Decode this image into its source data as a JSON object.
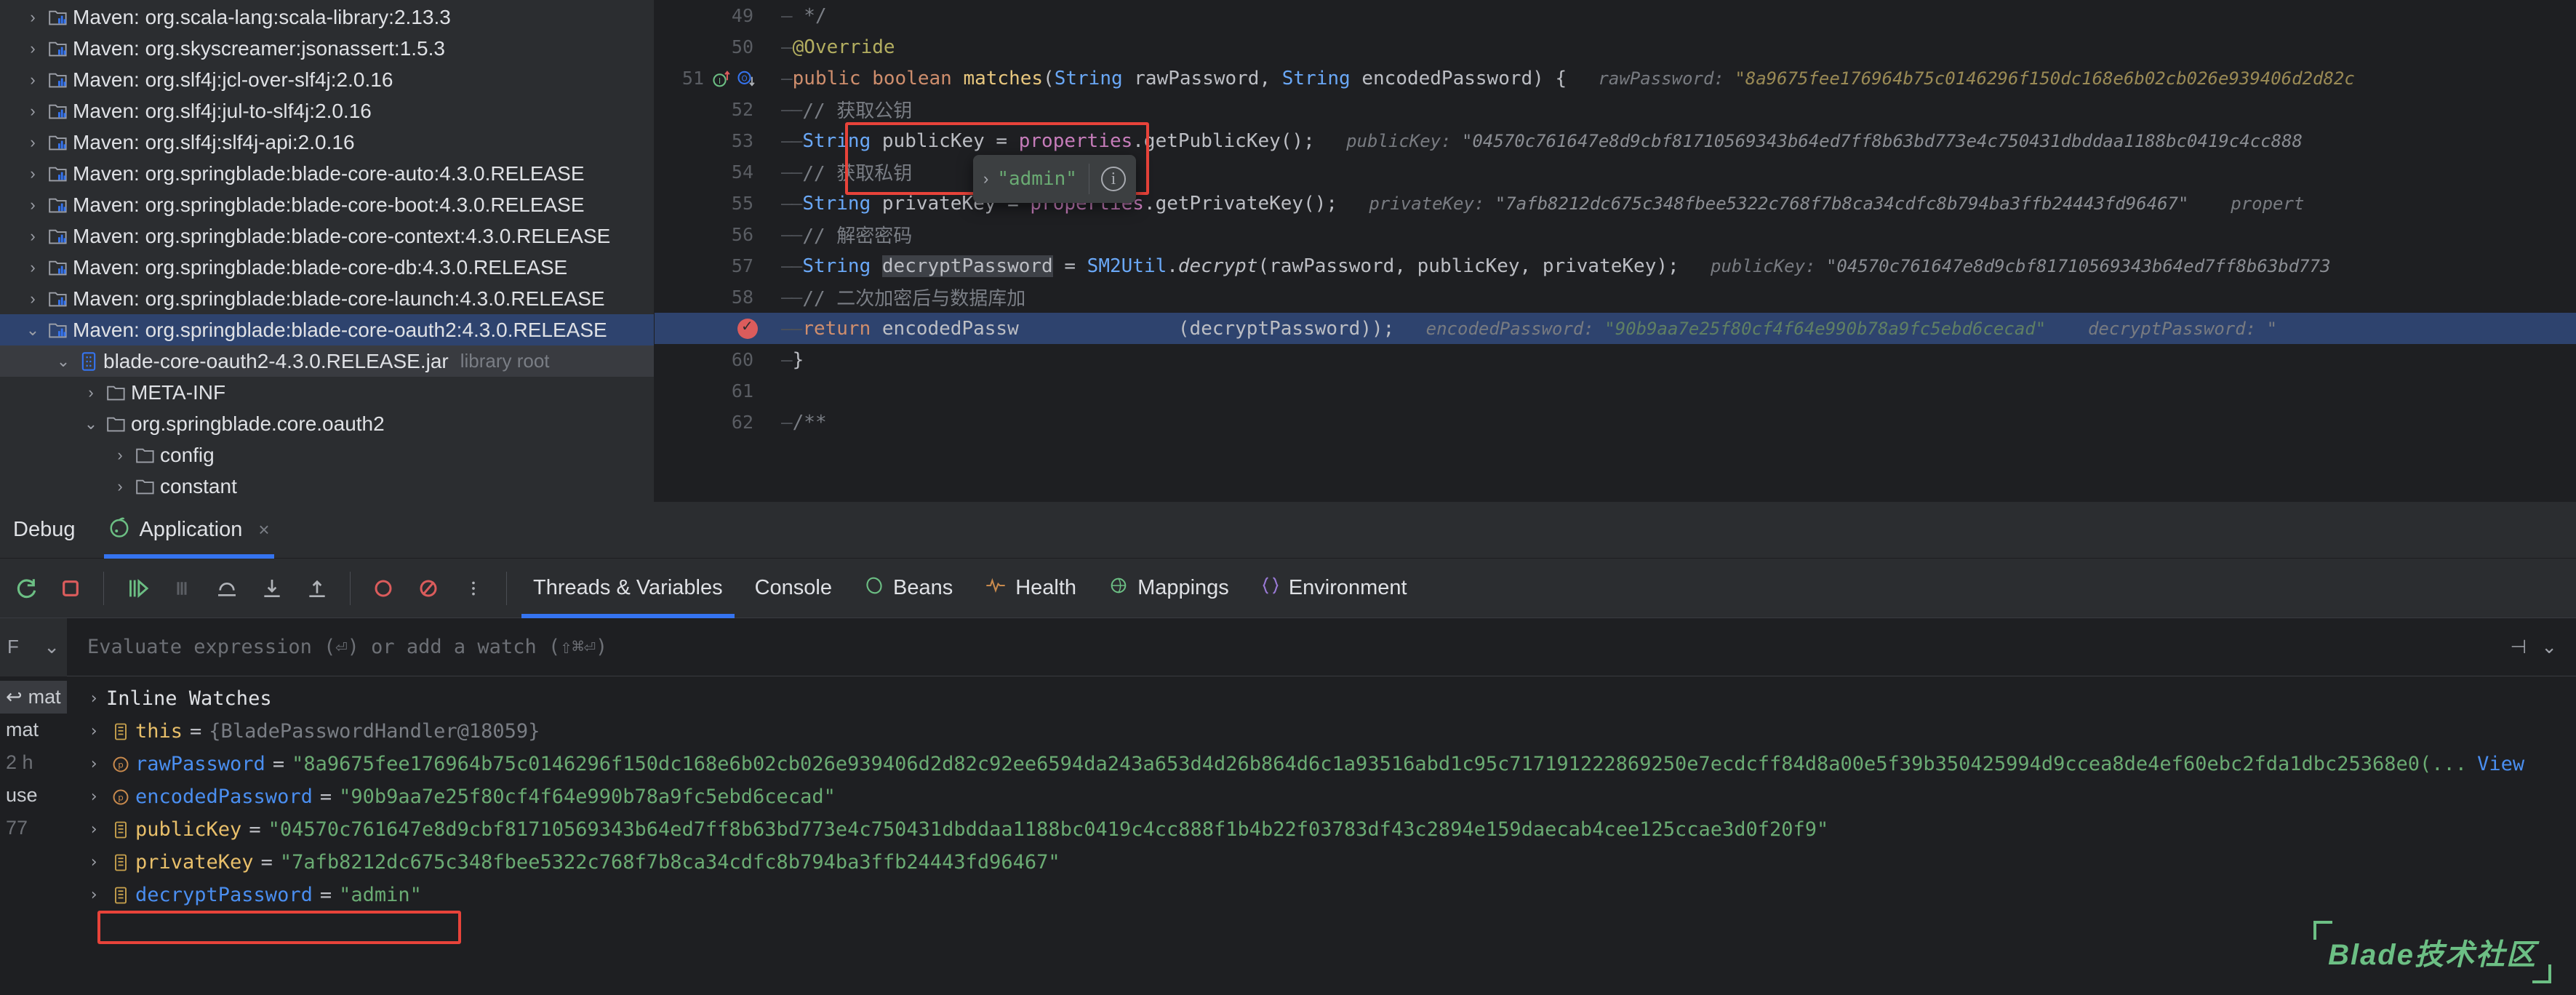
{
  "project_tree": {
    "rows": [
      {
        "indent": 1,
        "chev": "›",
        "icon": "maven-library-icon",
        "label": "Maven: org.scala-lang:scala-library:2.13.3",
        "state": "normal"
      },
      {
        "indent": 1,
        "chev": "›",
        "icon": "maven-library-icon",
        "label": "Maven: org.skyscreamer:jsonassert:1.5.3",
        "state": "normal"
      },
      {
        "indent": 1,
        "chev": "›",
        "icon": "maven-library-icon",
        "label": "Maven: org.slf4j:jcl-over-slf4j:2.0.16",
        "state": "normal"
      },
      {
        "indent": 1,
        "chev": "›",
        "icon": "maven-library-icon",
        "label": "Maven: org.slf4j:jul-to-slf4j:2.0.16",
        "state": "normal"
      },
      {
        "indent": 1,
        "chev": "›",
        "icon": "maven-library-icon",
        "label": "Maven: org.slf4j:slf4j-api:2.0.16",
        "state": "normal"
      },
      {
        "indent": 1,
        "chev": "›",
        "icon": "maven-library-icon",
        "label": "Maven: org.springblade:blade-core-auto:4.3.0.RELEASE",
        "state": "normal"
      },
      {
        "indent": 1,
        "chev": "›",
        "icon": "maven-library-icon",
        "label": "Maven: org.springblade:blade-core-boot:4.3.0.RELEASE",
        "state": "normal"
      },
      {
        "indent": 1,
        "chev": "›",
        "icon": "maven-library-icon",
        "label": "Maven: org.springblade:blade-core-context:4.3.0.RELEASE",
        "state": "normal"
      },
      {
        "indent": 1,
        "chev": "›",
        "icon": "maven-library-icon",
        "label": "Maven: org.springblade:blade-core-db:4.3.0.RELEASE",
        "state": "normal"
      },
      {
        "indent": 1,
        "chev": "›",
        "icon": "maven-library-icon",
        "label": "Maven: org.springblade:blade-core-launch:4.3.0.RELEASE",
        "state": "normal"
      },
      {
        "indent": 1,
        "chev": "⌄",
        "icon": "maven-library-icon",
        "label": "Maven: org.springblade:blade-core-oauth2:4.3.0.RELEASE",
        "state": "selected"
      },
      {
        "indent": 2,
        "chev": "⌄",
        "icon": "jar-icon",
        "label": "blade-core-oauth2-4.3.0.RELEASE.jar",
        "suffix": "library root",
        "state": "jar-selected"
      },
      {
        "indent": 3,
        "chev": "›",
        "icon": "folder-icon",
        "label": "META-INF",
        "state": "normal"
      },
      {
        "indent": 3,
        "chev": "⌄",
        "icon": "package-icon",
        "label": "org.springblade.core.oauth2",
        "state": "normal"
      },
      {
        "indent": 4,
        "chev": "›",
        "icon": "folder-icon",
        "label": "config",
        "state": "normal"
      },
      {
        "indent": 4,
        "chev": "›",
        "icon": "folder-icon",
        "label": "constant",
        "state": "normal"
      }
    ]
  },
  "editor": {
    "lines": [
      {
        "num": "49",
        "marks": [],
        "fold": "—",
        "highlight": false,
        "segments": [
          {
            "t": " */",
            "c": "cmt"
          }
        ]
      },
      {
        "num": "50",
        "marks": [],
        "fold": "—",
        "highlight": false,
        "segments": [
          {
            "t": "@Override",
            "c": "anno"
          }
        ]
      },
      {
        "num": "51",
        "marks": [
          "implementing-method-icon",
          "overriding-method-icon"
        ],
        "fold": "—",
        "highlight": false,
        "segments": [
          {
            "t": "public ",
            "c": "kw"
          },
          {
            "t": "boolean ",
            "c": "kw"
          },
          {
            "t": "matches",
            "c": "meth"
          },
          {
            "t": "(",
            "c": "plain"
          },
          {
            "t": "String",
            "c": "type"
          },
          {
            "t": " rawPassword, ",
            "c": "plain"
          },
          {
            "t": "String",
            "c": "type"
          },
          {
            "t": " encodedPassword) {",
            "c": "plain"
          },
          {
            "t": "   rawPassword:",
            "c": "hint"
          },
          {
            "t": " \"8a9675fee176964b75c0146296f150dc168e6b02cb026e939406d2d82c",
            "c": "hintval"
          }
        ]
      },
      {
        "num": "52",
        "marks": [],
        "fold": "——",
        "highlight": false,
        "segments": [
          {
            "t": "// 获取公钥",
            "c": "cmt"
          }
        ]
      },
      {
        "num": "53",
        "marks": [],
        "fold": "——",
        "highlight": false,
        "segments": [
          {
            "t": "String",
            "c": "type"
          },
          {
            "t": " publicKey = ",
            "c": "plain"
          },
          {
            "t": "properties",
            "c": "field"
          },
          {
            "t": ".getPublicKey();",
            "c": "plain"
          },
          {
            "t": "   publicKey:",
            "c": "hint"
          },
          {
            "t": " \"04570c761647e8d9cbf81710569343b64ed7ff8b63bd773e4c750431dbddaa1188bc0419c4cc888",
            "c": "hintlight"
          }
        ]
      },
      {
        "num": "54",
        "marks": [],
        "fold": "——",
        "highlight": false,
        "segments": [
          {
            "t": "// 获取私钥",
            "c": "cmt"
          }
        ]
      },
      {
        "num": "55",
        "marks": [],
        "fold": "——",
        "highlight": false,
        "segments": [
          {
            "t": "String",
            "c": "type"
          },
          {
            "t": " privateKey = ",
            "c": "plain"
          },
          {
            "t": "properties",
            "c": "field"
          },
          {
            "t": ".getPrivateKey();",
            "c": "plain"
          },
          {
            "t": "   privateKey:",
            "c": "hint"
          },
          {
            "t": " \"7afb8212dc675c348fbee5322c768f7b8ca34cdfc8b794ba3ffb24443fd96467\"",
            "c": "hintlight"
          },
          {
            "t": "    propert",
            "c": "hint"
          }
        ]
      },
      {
        "num": "56",
        "marks": [],
        "fold": "——",
        "highlight": false,
        "segments": [
          {
            "t": "// 解密密码",
            "c": "cmt"
          }
        ]
      },
      {
        "num": "57",
        "marks": [],
        "fold": "——",
        "highlight": false,
        "segments": [
          {
            "t": "String",
            "c": "type"
          },
          {
            "t": " ",
            "c": "plain"
          },
          {
            "t": "decryptPassword",
            "c": "sel-token"
          },
          {
            "t": " = ",
            "c": "plain"
          },
          {
            "t": "SM2Util",
            "c": "type"
          },
          {
            "t": ".",
            "c": "plain"
          },
          {
            "t": "decrypt",
            "c": "plain-italic"
          },
          {
            "t": "(rawPassword, publicKey, privateKey);",
            "c": "plain"
          },
          {
            "t": "   publicKey:",
            "c": "hint"
          },
          {
            "t": " \"04570c761647e8d9cbf81710569343b64ed7ff8b63bd773",
            "c": "hintlight"
          }
        ]
      },
      {
        "num": "58",
        "marks": [],
        "fold": "——",
        "highlight": false,
        "segments": [
          {
            "t": "// 二次加密后与数据库加",
            "c": "cmt"
          }
        ]
      },
      {
        "num": "",
        "marks": [
          "breakpoint-icon"
        ],
        "fold": "——",
        "highlight": true,
        "segments": [
          {
            "t": "return ",
            "c": "kw"
          },
          {
            "t": "encodedPassw",
            "c": "plain"
          },
          {
            "t": "              (decryptPassword));",
            "c": "plain"
          },
          {
            "t": "   encodedPassword:",
            "c": "hint"
          },
          {
            "t": " \"90b9aa7e25f80cf4f64e990b78a9fc5ebd6cecad\"",
            "c": "hintval2"
          },
          {
            "t": "    decryptPassword: \"",
            "c": "hint"
          }
        ]
      },
      {
        "num": "60",
        "marks": [],
        "fold": "—",
        "highlight": false,
        "segments": [
          {
            "t": "}",
            "c": "plain"
          }
        ]
      },
      {
        "num": "61",
        "marks": [],
        "fold": "",
        "highlight": false,
        "segments": []
      },
      {
        "num": "62",
        "marks": [],
        "fold": "—",
        "highlight": false,
        "segments": [
          {
            "t": "/**",
            "c": "cmt"
          }
        ]
      }
    ],
    "tooltip": {
      "chevron": "›",
      "value": "\"admin\"",
      "info_icon": "info-icon"
    }
  },
  "debug_panel": {
    "title": "Debug",
    "tab": {
      "label": "Application",
      "icon": "spring-boot-icon",
      "close": "×"
    },
    "toolbar_buttons": [
      {
        "name": "rerun-button",
        "glyph": "↻",
        "color": "#6cbf84"
      },
      {
        "name": "stop-button",
        "glyph": "■",
        "color": "#db5c5c"
      },
      {
        "name": "resume-button",
        "glyph": "▶",
        "color": "#6cbf84"
      },
      {
        "name": "pause-button",
        "glyph": "❚❚",
        "color": "#6d7076"
      },
      {
        "name": "step-over-button",
        "glyph": "⤼",
        "color": "#b0b3b8"
      },
      {
        "name": "step-into-button",
        "glyph": "↓",
        "color": "#b0b3b8"
      },
      {
        "name": "step-out-button",
        "glyph": "↑",
        "color": "#b0b3b8"
      },
      {
        "name": "view-breakpoints-button",
        "glyph": "◉",
        "color": "#db5c5c"
      },
      {
        "name": "mute-breakpoints-button",
        "glyph": "⊘",
        "color": "#db5c5c"
      },
      {
        "name": "more-options-button",
        "glyph": "⋮",
        "color": "#b0b3b8"
      }
    ],
    "sub_tabs": [
      {
        "label": "Threads & Variables",
        "icon": null,
        "active": true
      },
      {
        "label": "Console",
        "icon": null,
        "active": false
      },
      {
        "label": "Beans",
        "icon": "beans-icon",
        "active": false
      },
      {
        "label": "Health",
        "icon": "health-icon",
        "active": false
      },
      {
        "label": "Mappings",
        "icon": "mappings-icon",
        "active": false
      },
      {
        "label": "Environment",
        "icon": "environment-icon",
        "active": false
      }
    ],
    "evaluate": {
      "placeholder": "Evaluate expression (⏎) or add a watch (⇧⌘⏎)",
      "left_glyph": "⌄",
      "add_glyph": "⊣",
      "collapse_glyph": "⌄"
    },
    "frames": [
      {
        "label": "mat",
        "glyph": "↩",
        "selected": true,
        "muted": false
      },
      {
        "label": "mat",
        "glyph": "",
        "selected": false,
        "muted": false
      },
      {
        "label": "2 h",
        "glyph": "",
        "selected": false,
        "muted": true
      },
      {
        "label": "use",
        "glyph": "",
        "selected": false,
        "muted": false
      },
      {
        "label": "77",
        "glyph": "",
        "selected": false,
        "muted": true
      }
    ],
    "variables": [
      {
        "chev": "›",
        "icon": null,
        "name": "Inline Watches",
        "kind": "group"
      },
      {
        "chev": "›",
        "icon": "field-icon",
        "name": "this",
        "eq": "=",
        "value": "{BladePasswordHandler@18059}",
        "value_kind": "gray"
      },
      {
        "chev": "›",
        "icon": "param-icon",
        "name": "rawPassword",
        "name_kind": "blue",
        "eq": "=",
        "value": "\"8a9675fee176964b75c0146296f150dc168e6b02cb026e939406d2d82c92ee6594da243a653d4d26b864d6c1a93516abd1c95c717191222869250e7ecdcff84d8a00e5f39b350425994d9ccea8de4ef60ebc2fda1dbc25368e0(...",
        "value_kind": "string",
        "view_link": "View"
      },
      {
        "chev": "›",
        "icon": "param-icon",
        "name": "encodedPassword",
        "name_kind": "blue",
        "eq": "=",
        "value": "\"90b9aa7e25f80cf4f64e990b78a9fc5ebd6cecad\"",
        "value_kind": "string"
      },
      {
        "chev": "›",
        "icon": "field-icon",
        "name": "publicKey",
        "eq": "=",
        "value": "\"04570c761647e8d9cbf81710569343b64ed7ff8b63bd773e4c750431dbddaa1188bc0419c4cc888f1b4b22f03783df43c2894e159daecab4cee125ccae3d0f20f9\"",
        "value_kind": "string"
      },
      {
        "chev": "›",
        "icon": "field-icon",
        "name": "privateKey",
        "eq": "=",
        "value": "\"7afb8212dc675c348fbee5322c768f7b8ca34cdfc8b794ba3ffb24443fd96467\"",
        "value_kind": "string"
      },
      {
        "chev": "›",
        "icon": "field-icon",
        "name": "decryptPassword",
        "name_kind": "blue",
        "eq": "=",
        "value": "\"admin\"",
        "value_kind": "string",
        "highlighted": true
      }
    ]
  },
  "watermark": {
    "text": "Blade技术社区",
    "color": "#6cbf84"
  },
  "colors": {
    "background": "#1e1f22",
    "panel": "#2b2d30",
    "selection_blue": "#2e436e",
    "accent_blue": "#3574f0",
    "string_green": "#6aab73",
    "keyword_orange": "#cf8e6d",
    "type_blue": "#6aa8f7",
    "highlight_red": "#e8433a",
    "variable_yellow": "#e8bf6a"
  }
}
